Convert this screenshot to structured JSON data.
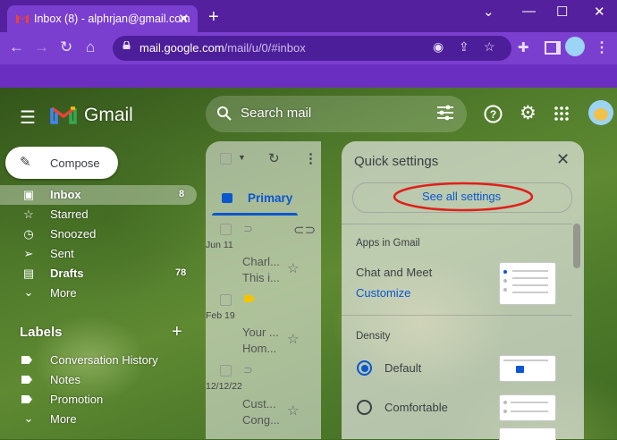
{
  "browser": {
    "tab_title": "Inbox (8) - alphrjan@gmail.com",
    "url_host": "mail.google.com",
    "url_path": "/mail/u/0/#inbox",
    "tab_close": "✕",
    "new_tab": "+",
    "win_min": "—",
    "win_max": "☐",
    "win_close": "✕",
    "back": "←",
    "forward": "→",
    "reload": "↻",
    "home": "⌂"
  },
  "header": {
    "product": "Gmail",
    "search_placeholder": "Search mail"
  },
  "compose_label": "Compose",
  "sidebar": {
    "items": [
      {
        "label": "Inbox",
        "count": "8",
        "icon": "inbox-icon"
      },
      {
        "label": "Starred",
        "count": "",
        "icon": "star-icon"
      },
      {
        "label": "Snoozed",
        "count": "",
        "icon": "clock-icon"
      },
      {
        "label": "Sent",
        "count": "",
        "icon": "send-icon"
      },
      {
        "label": "Drafts",
        "count": "78",
        "icon": "draft-icon"
      },
      {
        "label": "More",
        "count": "",
        "icon": "chevron-down-icon"
      }
    ],
    "labels_heading": "Labels",
    "labels": [
      {
        "label": "Conversation History"
      },
      {
        "label": "Notes"
      },
      {
        "label": "Promotion"
      },
      {
        "label": "More"
      }
    ]
  },
  "list": {
    "tab_primary": "Primary",
    "rows": [
      {
        "date": "Jun 11",
        "sender": "Charl...",
        "snippet": "This i..."
      },
      {
        "date": "Feb 19",
        "sender": "Your ...",
        "snippet": "Hom..."
      },
      {
        "date": "12/12/22",
        "sender": "Cust...",
        "snippet": "Cong..."
      }
    ]
  },
  "quick_settings": {
    "title": "Quick settings",
    "see_all": "See all settings",
    "apps_heading": "Apps in Gmail",
    "chat_meet": "Chat and Meet",
    "customize": "Customize",
    "density_heading": "Density",
    "options": [
      {
        "label": "Default",
        "selected": true
      },
      {
        "label": "Comfortable",
        "selected": false
      }
    ]
  },
  "colors": {
    "accent_blue": "#0b57d0",
    "annotation_red": "#e0201a",
    "chrome_purple": "#7b3fd0"
  }
}
